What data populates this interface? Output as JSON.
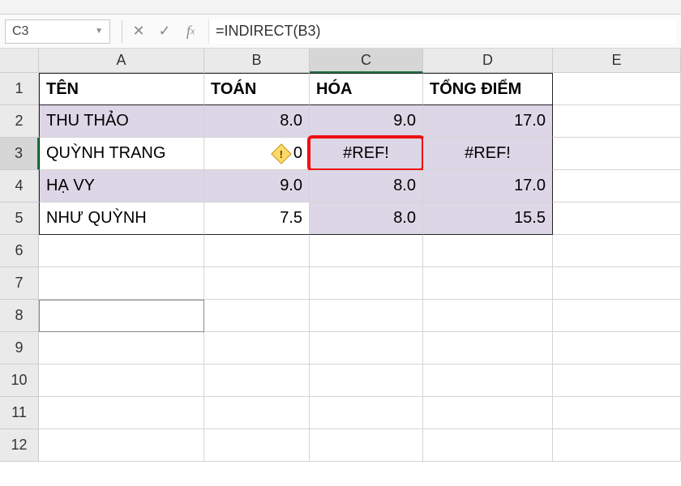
{
  "formula_bar": {
    "name_box": "C3",
    "formula": "=INDIRECT(B3)"
  },
  "columns": [
    "A",
    "B",
    "C",
    "D",
    "E"
  ],
  "rows": [
    "1",
    "2",
    "3",
    "4",
    "5",
    "6",
    "7",
    "8",
    "9",
    "10",
    "11",
    "12"
  ],
  "headers": {
    "A": "TÊN",
    "B": "TOÁN",
    "C": "HÓA",
    "D": "TỔNG ĐIỂM"
  },
  "data": {
    "r2": {
      "A": "THU THẢO",
      "B": "8.0",
      "C": "9.0",
      "D": "17.0"
    },
    "r3": {
      "A": "QUỲNH TRANG",
      "B": "0",
      "C": "#REF!",
      "D": "#REF!"
    },
    "r4": {
      "A": "HẠ VY",
      "B": "9.0",
      "C": "8.0",
      "D": "17.0"
    },
    "r5": {
      "A": "NHƯ QUỲNH",
      "B": "7.5",
      "C": "8.0",
      "D": "15.5"
    }
  },
  "chart_data": {
    "type": "table",
    "title": "",
    "columns": [
      "TÊN",
      "TOÁN",
      "HÓA",
      "TỔNG ĐIỂM"
    ],
    "rows": [
      [
        "THU THẢO",
        8.0,
        9.0,
        17.0
      ],
      [
        "QUỲNH TRANG",
        0,
        "#REF!",
        "#REF!"
      ],
      [
        "HẠ VY",
        9.0,
        8.0,
        17.0
      ],
      [
        "NHƯ QUỲNH",
        7.5,
        8.0,
        15.5
      ]
    ]
  }
}
